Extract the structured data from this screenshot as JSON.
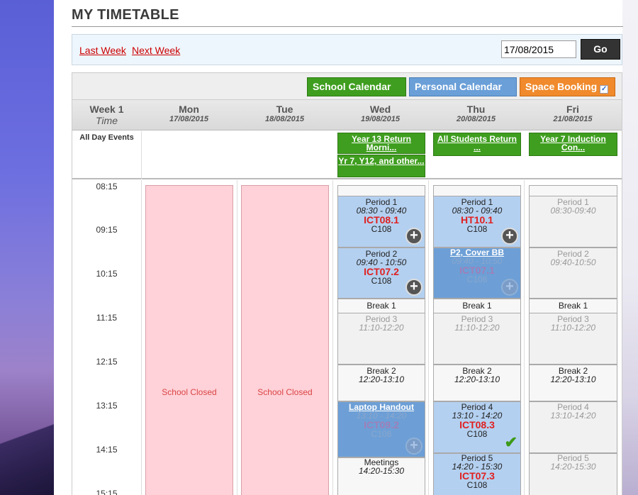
{
  "page": {
    "title": "MY TIMETABLE"
  },
  "nav": {
    "last_week": "Last Week",
    "next_week": "Next Week",
    "date_value": "17/08/2015",
    "go": "Go"
  },
  "legend": {
    "school": "School Calendar",
    "personal": "Personal Calendar",
    "space": "Space Booking",
    "colors": {
      "school": "#3f9e1f",
      "personal": "#6a9fd8",
      "space": "#f08a2c"
    }
  },
  "header": {
    "week": "Week 1",
    "time": "Time",
    "days": [
      {
        "name": "Mon",
        "date": "17/08/2015"
      },
      {
        "name": "Tue",
        "date": "18/08/2015"
      },
      {
        "name": "Wed",
        "date": "19/08/2015"
      },
      {
        "name": "Thu",
        "date": "20/08/2015"
      },
      {
        "name": "Fri",
        "date": "21/08/2015"
      }
    ]
  },
  "allday": {
    "label": "All Day Events",
    "events": {
      "wed1": "Year 13 Return Morni...",
      "wed2": "Yr 7, Y12, and other...",
      "thu1": "All Students Return ...",
      "fri1": "Year 7 Induction Con..."
    }
  },
  "times": [
    "08:15",
    "09:15",
    "10:15",
    "11:15",
    "12:15",
    "13:15",
    "14:15",
    "15:15"
  ],
  "closed": {
    "mon": "School Closed",
    "tue": "School Closed"
  },
  "wed": {
    "p1": {
      "title": "Period 1",
      "time": "08:30 - 09:40",
      "code": "ICT08.1",
      "room": "C108"
    },
    "p2": {
      "title": "Period 2",
      "time": "09:40 - 10:50",
      "code": "ICT07.2",
      "room": "C108"
    },
    "break1": "Break 1",
    "p3": {
      "title": "Period 3",
      "time": "11:10-12:20"
    },
    "break2": {
      "title": "Break 2",
      "time": "12:20-13:10"
    },
    "p4": {
      "overlay": "Laptop Handout",
      "time": "13:10 - 14:20",
      "code": "ICT09.2",
      "room": "C108"
    },
    "p5": {
      "title": "Meetings",
      "time": "14:20-15:30"
    }
  },
  "thu": {
    "p1": {
      "title": "Period 1",
      "time": "08:30 - 09:40",
      "code": "HT10.1",
      "room": "C108"
    },
    "p2": {
      "overlay": "P2, Cover BB",
      "time": "09:40 - 10:50",
      "code": "ICT07.1",
      "room": "C108"
    },
    "break1": "Break 1",
    "p3": {
      "title": "Period 3",
      "time": "11:10-12:20"
    },
    "break2": {
      "title": "Break 2",
      "time": "12:20-13:10"
    },
    "p4": {
      "title": "Period 4",
      "time": "13:10 - 14:20",
      "code": "ICT08.3",
      "room": "C108"
    },
    "p5": {
      "title": "Period 5",
      "time": "14:20 - 15:30",
      "code": "ICT07.3",
      "room": "C108"
    }
  },
  "fri": {
    "p1": {
      "title": "Period 1",
      "time": "08:30-09:40"
    },
    "p2": {
      "title": "Period 2",
      "time": "09:40-10:50"
    },
    "break1": "Break 1",
    "p3": {
      "title": "Period 3",
      "time": "11:10-12:20"
    },
    "break2": {
      "title": "Break 2",
      "time": "12:20-13:10"
    },
    "p4": {
      "title": "Period 4",
      "time": "13:10-14:20"
    },
    "p5": {
      "title": "Period 5",
      "time": "14:20-15:30"
    }
  }
}
